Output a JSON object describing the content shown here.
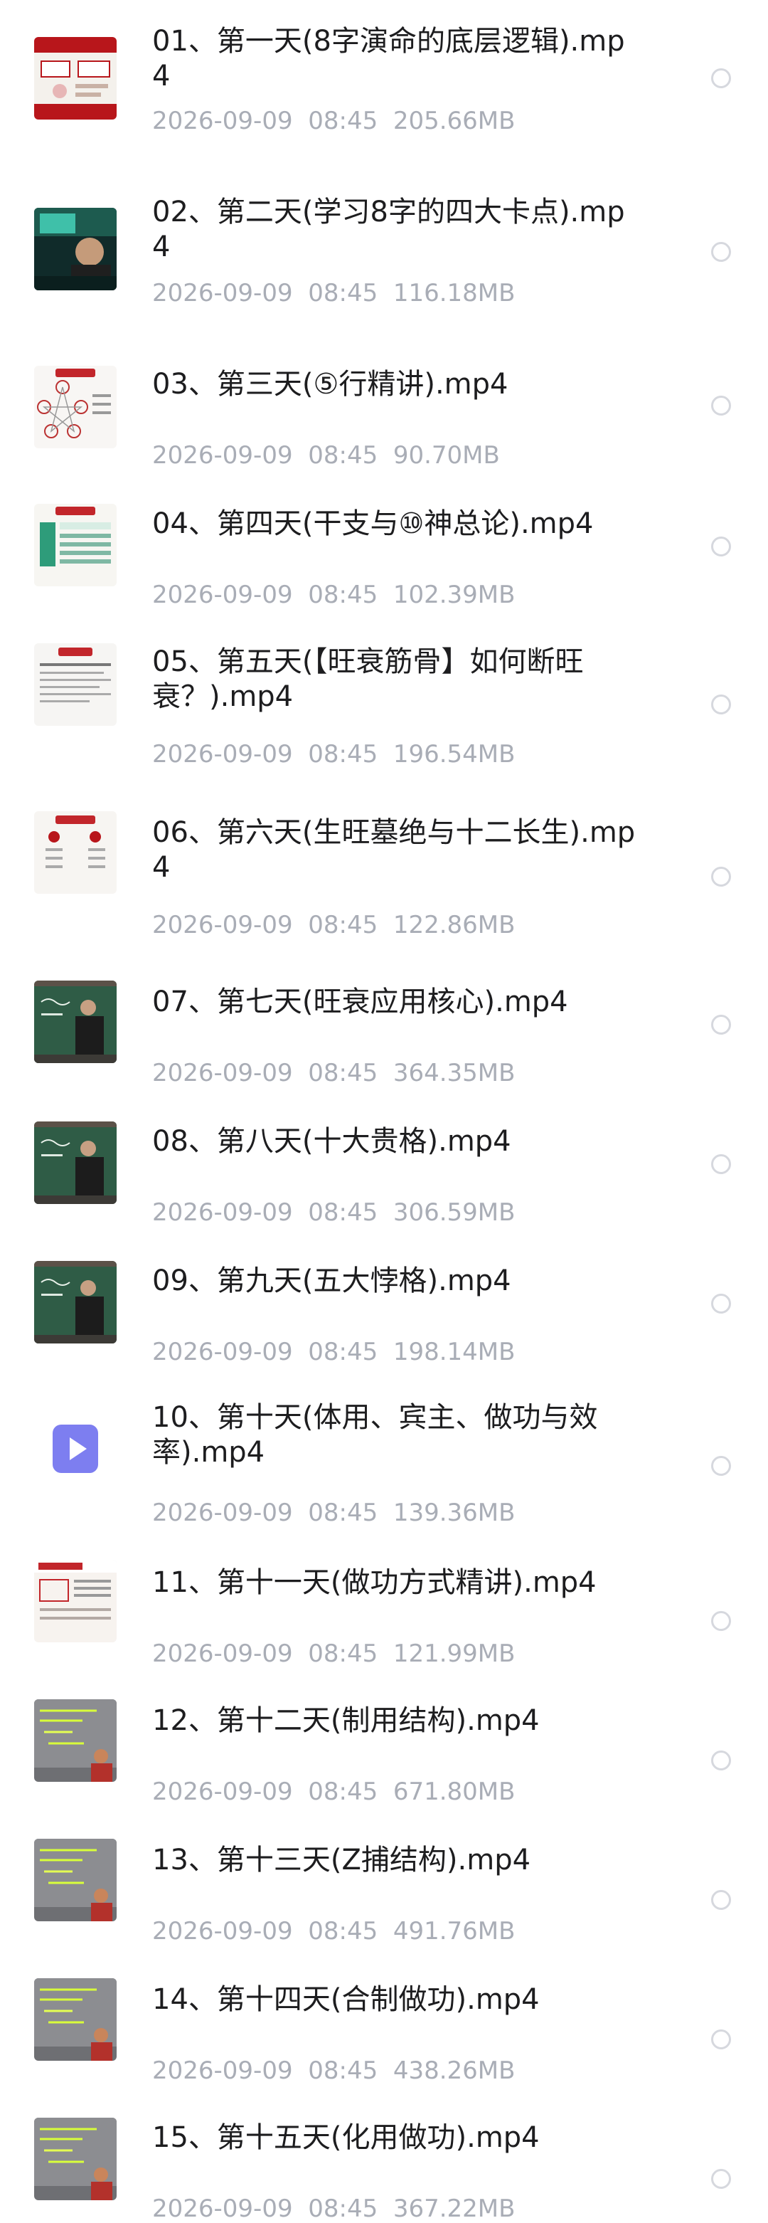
{
  "files": [
    {
      "name": "01、第一天(8字演命的底层逻辑).mp4",
      "date": "2026-09-09",
      "time": "08:45",
      "size": "205.66MB",
      "thumb": "red-slide"
    },
    {
      "name": "02、第二天(学习8字的四大卡点).mp4",
      "date": "2026-09-09",
      "time": "08:45",
      "size": "116.18MB",
      "thumb": "presenter-video"
    },
    {
      "name": "03、第三天(⑤行精讲).mp4",
      "date": "2026-09-09",
      "time": "08:45",
      "size": "90.70MB",
      "thumb": "five-elements-diagram"
    },
    {
      "name": "04、第四天(干支与⑩神总论).mp4",
      "date": "2026-09-09",
      "time": "08:45",
      "size": "102.39MB",
      "thumb": "green-table-slide"
    },
    {
      "name": "05、第五天(【旺衰筋骨】如何断旺衰？).mp4",
      "date": "2026-09-09",
      "time": "08:45",
      "size": "196.54MB",
      "thumb": "text-slide"
    },
    {
      "name": "06、第六天(生旺墓绝与十二长生).mp4",
      "date": "2026-09-09",
      "time": "08:45",
      "size": "122.86MB",
      "thumb": "list-slide"
    },
    {
      "name": "07、第七天(旺衰应用核心).mp4",
      "date": "2026-09-09",
      "time": "08:45",
      "size": "364.35MB",
      "thumb": "chalkboard-lecture"
    },
    {
      "name": "08、第八天(十大贵格).mp4",
      "date": "2026-09-09",
      "time": "08:45",
      "size": "306.59MB",
      "thumb": "chalkboard-lecture"
    },
    {
      "name": "09、第九天(五大悖格).mp4",
      "date": "2026-09-09",
      "time": "08:45",
      "size": "198.14MB",
      "thumb": "chalkboard-lecture"
    },
    {
      "name": "10、第十天(体用、宾主、做功与效率).mp4",
      "date": "2026-09-09",
      "time": "08:45",
      "size": "139.36MB",
      "thumb": "video-file-icon"
    },
    {
      "name": "11、第十一天(做功方式精讲).mp4",
      "date": "2026-09-09",
      "time": "08:45",
      "size": "121.99MB",
      "thumb": "red-text-slide"
    },
    {
      "name": "12、第十二天(制用结构).mp4",
      "date": "2026-09-09",
      "time": "08:45",
      "size": "671.80MB",
      "thumb": "whiteboard-lecture"
    },
    {
      "name": "13、第十三天(Z捕结构).mp4",
      "date": "2026-09-09",
      "time": "08:45",
      "size": "491.76MB",
      "thumb": "whiteboard-lecture"
    },
    {
      "name": "14、第十四天(合制做功).mp4",
      "date": "2026-09-09",
      "time": "08:45",
      "size": "438.26MB",
      "thumb": "whiteboard-lecture"
    },
    {
      "name": "15、第十五天(化用做功).mp4",
      "date": "2026-09-09",
      "time": "08:45",
      "size": "367.22MB",
      "thumb": "whiteboard-lecture"
    }
  ]
}
